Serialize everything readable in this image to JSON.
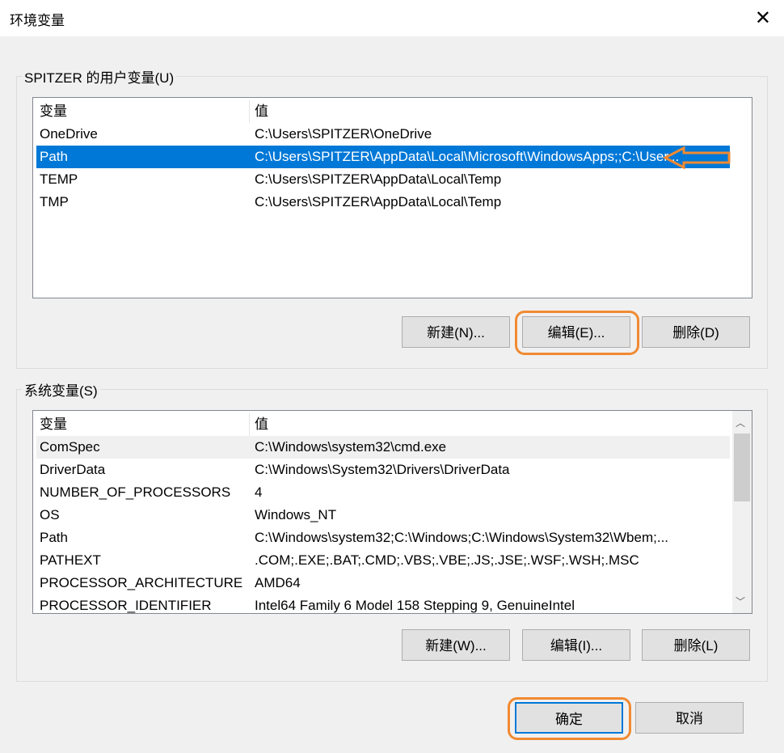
{
  "window": {
    "title": "环境变量",
    "close": "✕"
  },
  "user": {
    "label": "SPITZER 的用户变量(U)",
    "headers": [
      "变量",
      "值"
    ],
    "rows": [
      [
        "OneDrive",
        "C:\\Users\\SPITZER\\OneDrive"
      ],
      [
        "Path",
        "C:\\Users\\SPITZER\\AppData\\Local\\Microsoft\\WindowsApps;;C:\\User..."
      ],
      [
        "TEMP",
        "C:\\Users\\SPITZER\\AppData\\Local\\Temp"
      ],
      [
        "TMP",
        "C:\\Users\\SPITZER\\AppData\\Local\\Temp"
      ]
    ],
    "buttons": {
      "new": "新建(N)...",
      "edit": "编辑(E)...",
      "delete": "删除(D)"
    }
  },
  "system": {
    "label": "系统变量(S)",
    "headers": [
      "变量",
      "值"
    ],
    "rows": [
      [
        "ComSpec",
        "C:\\Windows\\system32\\cmd.exe"
      ],
      [
        "DriverData",
        "C:\\Windows\\System32\\Drivers\\DriverData"
      ],
      [
        "NUMBER_OF_PROCESSORS",
        "4"
      ],
      [
        "OS",
        "Windows_NT"
      ],
      [
        "Path",
        "C:\\Windows\\system32;C:\\Windows;C:\\Windows\\System32\\Wbem;..."
      ],
      [
        "PATHEXT",
        ".COM;.EXE;.BAT;.CMD;.VBS;.VBE;.JS;.JSE;.WSF;.WSH;.MSC"
      ],
      [
        "PROCESSOR_ARCHITECTURE",
        "AMD64"
      ],
      [
        "PROCESSOR_IDENTIFIER",
        "Intel64 Family 6 Model 158 Stepping 9, GenuineIntel"
      ]
    ],
    "buttons": {
      "new": "新建(W)...",
      "edit": "编辑(I)...",
      "delete": "删除(L)"
    }
  },
  "footer": {
    "ok": "确定",
    "cancel": "取消"
  },
  "colors": {
    "highlight": "#f08a32",
    "selection": "#0078d7"
  }
}
